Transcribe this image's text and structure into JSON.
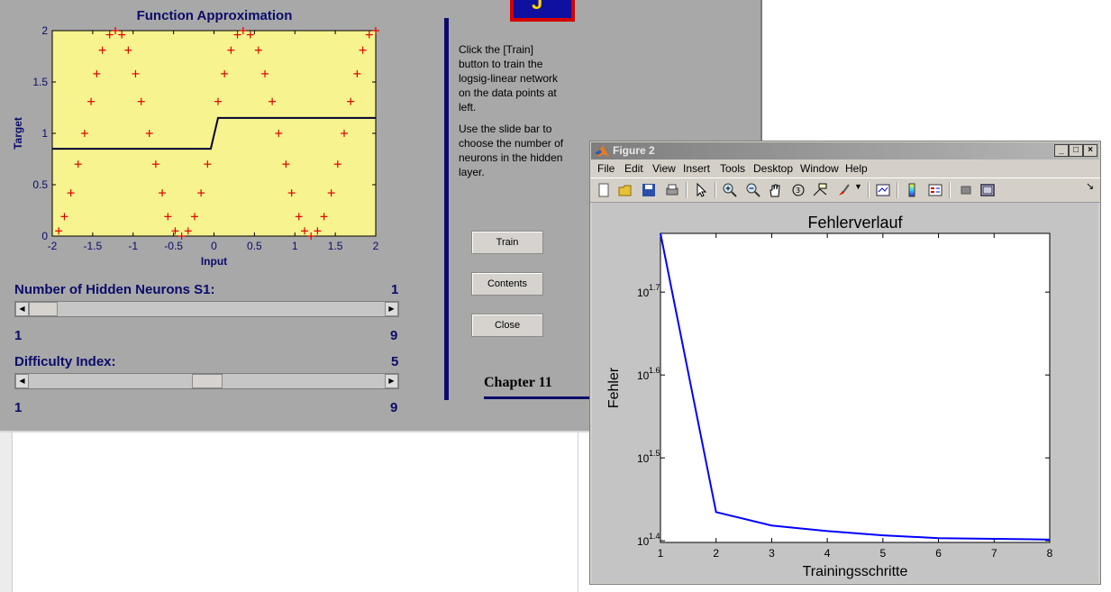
{
  "demo": {
    "plot_title": "Function Approximation",
    "xlabel": "Input",
    "ylabel": "Target",
    "x_ticks": [
      "-2",
      "-1.5",
      "-1",
      "-0.5",
      "0",
      "0.5",
      "1",
      "1.5",
      "2"
    ],
    "y_ticks": [
      "0",
      "0.5",
      "1",
      "1.5",
      "2"
    ],
    "hidden_neurons_label": "Number of Hidden Neurons S1:",
    "hidden_neurons_value": "1",
    "hidden_min": "1",
    "hidden_max": "9",
    "difficulty_label": "Difficulty Index:",
    "difficulty_value": "5",
    "difficulty_min": "1",
    "difficulty_max": "9",
    "hidden_slider_level": 0,
    "difficulty_slider_level": 0.5,
    "info_1": "Click the [Train] button to train the logsig-linear network on the data points at left.",
    "info_2": "Use the slide bar to choose the number of neurons in the hidden layer.",
    "train_button": "Train",
    "contents_button": "Contents",
    "close_button": "Close",
    "chapter": "Chapter 11",
    "colors": {
      "axes_bg": "#f7f38e",
      "marker": "#e00000",
      "navy": "#0b0b6b"
    }
  },
  "figure": {
    "window_title": "Figure 2",
    "menu": [
      "File",
      "Edit",
      "View",
      "Insert",
      "Tools",
      "Desktop",
      "Window",
      "Help"
    ],
    "toolbar_icons": [
      "new-file-icon",
      "open-folder-icon",
      "save-icon",
      "print-icon",
      "pointer-icon",
      "zoom-in-icon",
      "zoom-out-icon",
      "pan-hand-icon",
      "rotate-3d-icon",
      "data-cursor-icon",
      "brush-icon",
      "dropdown-arrow-icon",
      "link-plot-icon",
      "colorbar-icon",
      "legend-icon",
      "hide-plot-tools-icon",
      "show-plot-tools-icon"
    ],
    "window_buttons": [
      "_",
      "□",
      "×"
    ]
  },
  "chart_data": [
    {
      "type": "scatter",
      "title": "Function Approximation",
      "xlabel": "Input",
      "ylabel": "Target",
      "xlim": [
        -2,
        2
      ],
      "ylim": [
        0,
        2
      ],
      "series": [
        {
          "marker": "+",
          "x": [
            -1.92,
            -1.85,
            -1.77,
            -1.68,
            -1.6,
            -1.52,
            -1.45,
            -1.38,
            -1.29,
            -1.22,
            -1.14,
            -1.06,
            -0.97,
            -0.9,
            -0.8,
            -0.72,
            -0.64,
            -0.57,
            -0.48,
            -0.4,
            -0.32,
            -0.24,
            -0.16,
            -0.08,
            0.05,
            0.13,
            0.21,
            0.29,
            0.36,
            0.45,
            0.55,
            0.63,
            0.72,
            0.8,
            0.89,
            0.96,
            1.05,
            1.12,
            1.2,
            1.28,
            1.36,
            1.45,
            1.53,
            1.61,
            1.69,
            1.77,
            1.84,
            1.92,
            2.0
          ],
          "y": [
            0.05,
            0.19,
            0.42,
            0.7,
            1.0,
            1.31,
            1.58,
            1.81,
            1.96,
            2.0,
            1.96,
            1.81,
            1.58,
            1.31,
            1.0,
            0.7,
            0.42,
            0.19,
            0.05,
            0.0,
            0.05,
            0.19,
            0.42,
            0.7,
            1.31,
            1.58,
            1.81,
            1.96,
            2.0,
            1.96,
            1.81,
            1.58,
            1.31,
            1.0,
            0.7,
            0.42,
            0.19,
            0.05,
            0.0,
            0.05,
            0.19,
            0.42,
            0.7,
            1.0,
            1.31,
            1.58,
            1.81,
            1.96,
            2.0
          ]
        },
        {
          "type": "line",
          "x": [
            -2,
            -0.04,
            -0.01,
            0.02,
            0.05,
            2
          ],
          "y": [
            0.85,
            0.85,
            0.95,
            1.05,
            1.15,
            1.15
          ]
        }
      ]
    },
    {
      "type": "line",
      "title": "Fehlerverlauf",
      "xlabel": "Trainingsschritte",
      "ylabel": "Fehler",
      "y_scale": "log",
      "xlim": [
        1,
        8
      ],
      "ylim": [
        25,
        59
      ],
      "x_ticks": [
        "1",
        "2",
        "3",
        "4",
        "5",
        "6",
        "7",
        "8"
      ],
      "y_ticks": [
        {
          "base": "10",
          "exp": "1.4",
          "value": 25.12
        },
        {
          "base": "10",
          "exp": "1.5",
          "value": 31.62
        },
        {
          "base": "10",
          "exp": "1.6",
          "value": 39.81
        },
        {
          "base": "10",
          "exp": "1.7",
          "value": 50.12
        }
      ],
      "series": [
        {
          "x": [
            1,
            2,
            3,
            4,
            5,
            6,
            7,
            8
          ],
          "y": [
            59,
            27.2,
            26.2,
            25.8,
            25.5,
            25.3,
            25.25,
            25.2
          ],
          "color": "#0000ff"
        }
      ]
    }
  ]
}
